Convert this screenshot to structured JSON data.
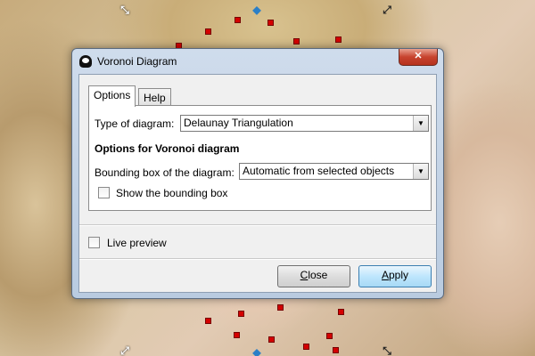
{
  "window": {
    "title": "Voronoi Diagram",
    "close_glyph": "✕"
  },
  "tabs": [
    {
      "label": "Options",
      "active": true
    },
    {
      "label": "Help",
      "active": false
    }
  ],
  "options": {
    "type_label": "Type of diagram:",
    "type_value": "Delaunay Triangulation",
    "section_heading": "Options for Voronoi diagram",
    "bbox_label": "Bounding box of the diagram:",
    "bbox_value": "Automatic from selected objects",
    "show_bbox_label": "Show the bounding box",
    "show_bbox_checked": false
  },
  "live_preview": {
    "label": "Live preview",
    "checked": false
  },
  "buttons": {
    "close_mnemonic": "C",
    "close_rest": "lose",
    "apply_mnemonic": "A",
    "apply_rest": "pply"
  },
  "icons": {
    "app": "inkscape-icon",
    "dropdown": "chevron-down-icon",
    "resize": "resize-arrow-icon"
  }
}
